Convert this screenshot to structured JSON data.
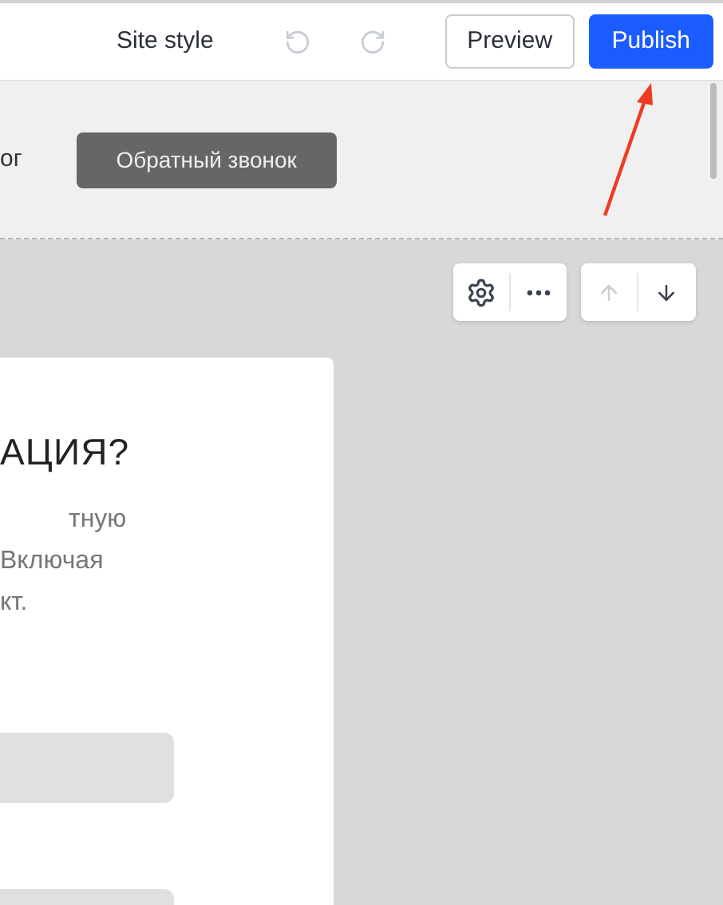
{
  "toolbar": {
    "site_style": "Site style",
    "undo": {
      "disabled": true
    },
    "redo": {
      "disabled": true
    },
    "preview": "Preview",
    "publish": "Publish"
  },
  "header": {
    "nav_item": "ог",
    "callback_button": "Обратный звонок"
  },
  "block_controls": {
    "move_up": {
      "disabled": true
    },
    "move_down": {
      "disabled": false
    }
  },
  "card": {
    "heading": "АЦИЯ?",
    "paragraph_lines": [
      "тную",
      "Включая",
      "кт."
    ],
    "fields": [
      {
        "kind": "input"
      },
      {
        "kind": "input"
      }
    ]
  }
}
